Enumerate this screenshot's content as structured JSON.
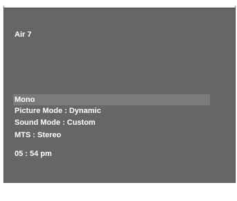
{
  "channel": {
    "label": "Air 7"
  },
  "info": {
    "audio": "Mono",
    "picture_mode": "Picture Mode : Dynamic",
    "sound_mode": "Sound Mode : Custom",
    "mts": "MTS : Stereo",
    "time": "05 : 54 pm"
  },
  "colors": {
    "background": "#666666",
    "highlight": "#7b7b7b",
    "text": "#ffffff"
  }
}
